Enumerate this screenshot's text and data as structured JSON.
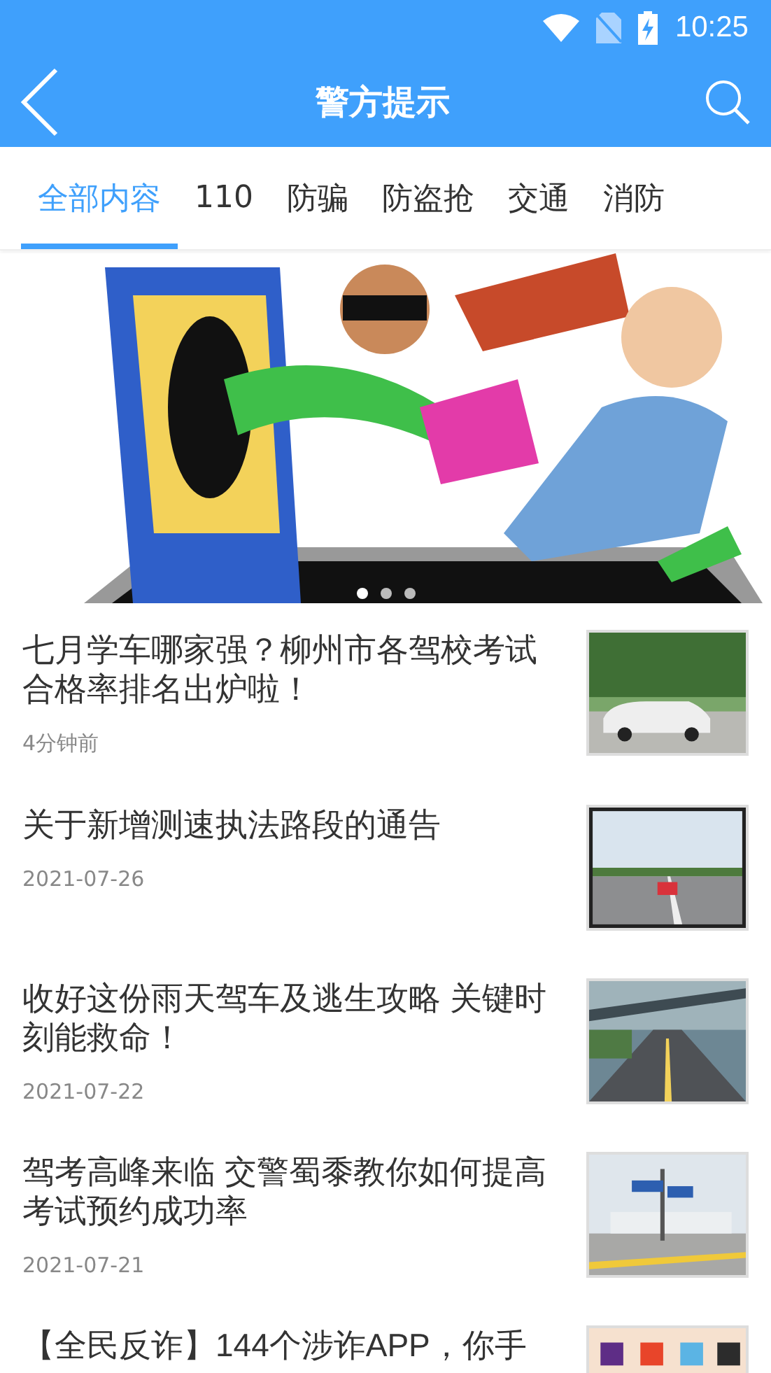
{
  "status_bar": {
    "time": "10:25"
  },
  "header": {
    "title": "警方提示"
  },
  "tabs": [
    {
      "label": "全部内容",
      "selected": true
    },
    {
      "label": "110",
      "selected": false
    },
    {
      "label": "防骗",
      "selected": false
    },
    {
      "label": "防盗抢",
      "selected": false
    },
    {
      "label": "交通",
      "selected": false
    },
    {
      "label": "消防",
      "selected": false
    }
  ],
  "banner": {
    "slides": [
      {
        "selected": true
      },
      {
        "selected": false
      },
      {
        "selected": false
      }
    ]
  },
  "articles": [
    {
      "title": "七月学车哪家强？柳州市各驾校考试合格率排名出炉啦！",
      "time": "4分钟前"
    },
    {
      "title": "关于新增测速执法路段的通告",
      "time": "2021-07-26"
    },
    {
      "title": "收好这份雨天驾车及逃生攻略 关键时刻能救命！",
      "time": "2021-07-22"
    },
    {
      "title": "驾考高峰来临 交警蜀黍教你如何提高考试预约成功率",
      "time": "2021-07-21"
    },
    {
      "title": "【全民反诈】144个涉诈APP，你手"
    }
  ]
}
